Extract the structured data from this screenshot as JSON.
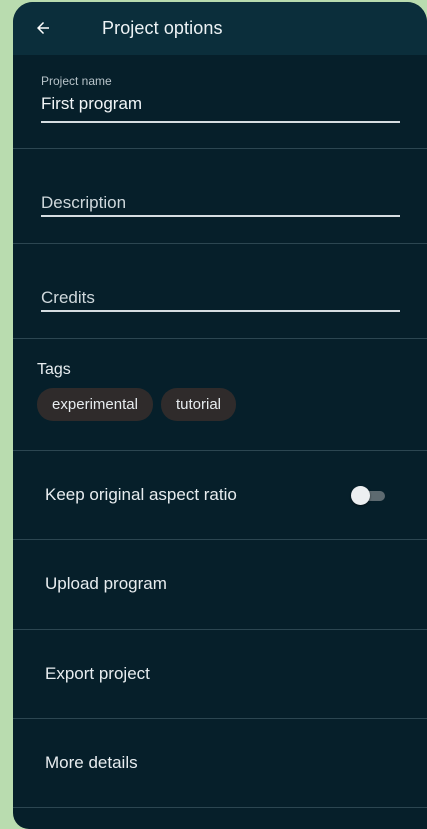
{
  "appbar": {
    "title": "Project options",
    "back_icon": "arrow-back-icon"
  },
  "form": {
    "project_name_label": "Project name",
    "project_name_value": "First program",
    "description_placeholder": "Description",
    "credits_placeholder": "Credits"
  },
  "tags": {
    "title": "Tags",
    "items": [
      "experimental",
      "tutorial"
    ]
  },
  "options": {
    "aspect_ratio_label": "Keep original aspect ratio",
    "aspect_ratio_enabled": false,
    "upload_label": "Upload program",
    "export_label": "Export project",
    "more_details_label": "More details"
  },
  "colors": {
    "background": "#b9dcaf",
    "surface": "#061f2a",
    "appbar": "#0b2e3b",
    "chip": "#2f2b2b"
  }
}
